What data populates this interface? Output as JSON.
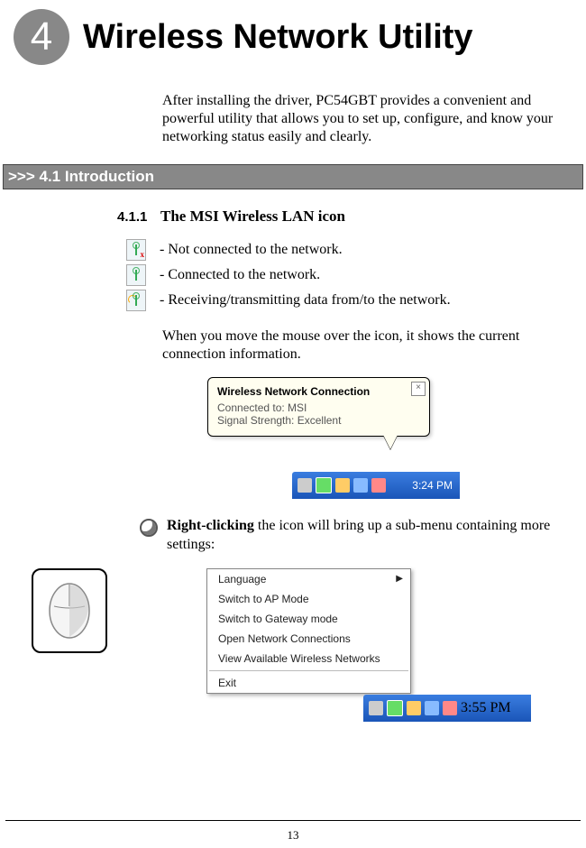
{
  "chapter": {
    "number": "4",
    "title": "Wireless Network Utility"
  },
  "intro": "After installing the driver, PC54GBT provides a convenient and powerful utility that allows you to set up, configure, and know your networking status easily and clearly.",
  "section": {
    "header": ">>> 4.1  Introduction"
  },
  "subsection": {
    "num": "4.1.1",
    "title": "The MSI Wireless LAN icon"
  },
  "icons": {
    "disconnected": "- Not connected to the network.",
    "connected": "- Connected to the network.",
    "activity": "- Receiving/transmitting data from/to the network."
  },
  "hover_text": "When you move the mouse over the icon, it shows the current connection information.",
  "tooltip": {
    "title": "Wireless Network Connection",
    "line1": "Connected to: MSI",
    "line2": "Signal Strength: Excellent",
    "time": "3:24 PM"
  },
  "rightclick": {
    "lead": "Right-clicking",
    "rest": " the icon will bring up a sub-menu containing more settings:"
  },
  "context_menu": {
    "items": [
      "Language",
      "Switch to AP Mode",
      "Switch to Gateway mode",
      "Open Network Connections",
      "View Available Wireless Networks"
    ],
    "exit": "Exit",
    "time": "3:55 PM"
  },
  "page_number": "13"
}
